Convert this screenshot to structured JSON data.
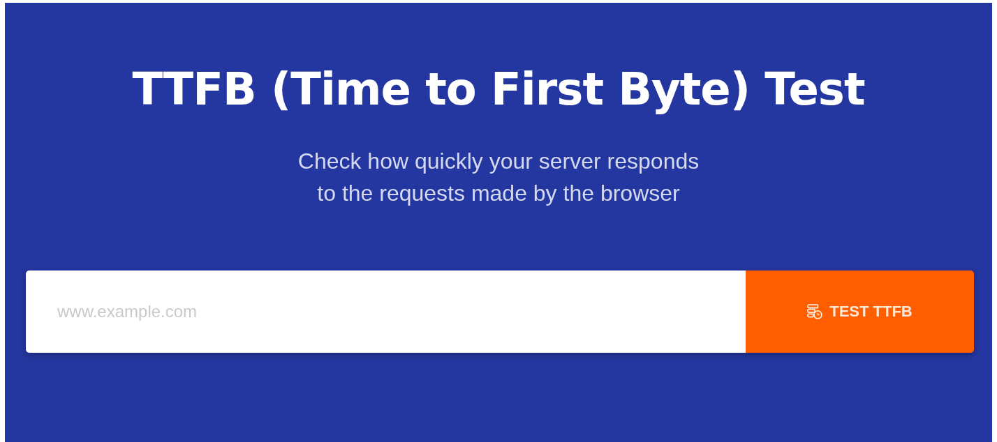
{
  "title": "TTFB (Time to First Byte) Test",
  "subtitle_lines": [
    "Check how quickly your server responds",
    "to the requests made by the browser"
  ],
  "url_field": {
    "placeholder": "www.example.com"
  },
  "test_button": {
    "label": "TEST TTFB"
  }
}
